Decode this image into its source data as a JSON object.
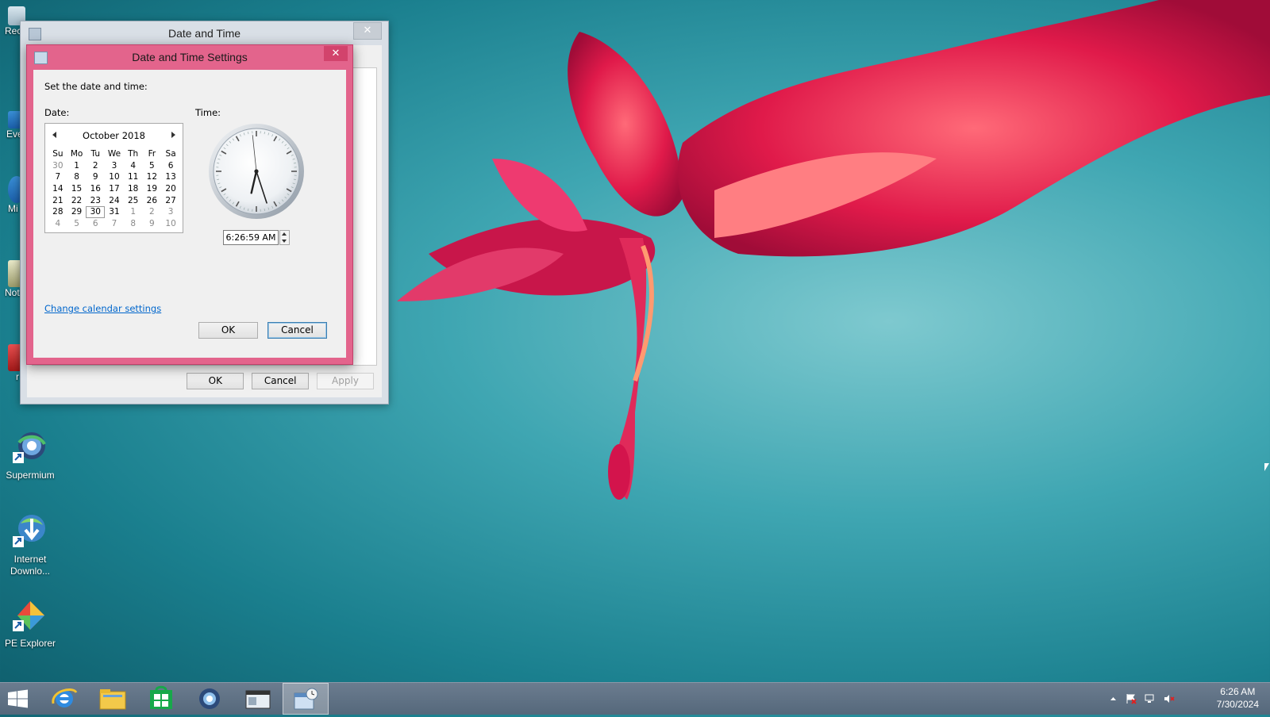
{
  "desktop": {
    "icons": [
      {
        "label": "Supermium"
      },
      {
        "label": "Internet Downlo..."
      },
      {
        "label": "PE Explorer"
      }
    ],
    "partial_labels": [
      "Rec",
      "Eve",
      "Mi",
      "Not",
      "r"
    ]
  },
  "outer_window": {
    "title": "Date and Time",
    "buttons": {
      "ok": "OK",
      "cancel": "Cancel",
      "apply": "Apply"
    }
  },
  "dialog": {
    "title": "Date and Time Settings",
    "instruction": "Set the date and time:",
    "date_label": "Date:",
    "time_label": "Time:",
    "calendar": {
      "month": "October 2018",
      "weekdays": [
        "Su",
        "Mo",
        "Tu",
        "We",
        "Th",
        "Fr",
        "Sa"
      ],
      "weeks": [
        [
          "30",
          "1",
          "2",
          "3",
          "4",
          "5",
          "6"
        ],
        [
          "7",
          "8",
          "9",
          "10",
          "11",
          "12",
          "13"
        ],
        [
          "14",
          "15",
          "16",
          "17",
          "18",
          "19",
          "20"
        ],
        [
          "21",
          "22",
          "23",
          "24",
          "25",
          "26",
          "27"
        ],
        [
          "28",
          "29",
          "30",
          "31",
          "1",
          "2",
          "3"
        ],
        [
          "4",
          "5",
          "6",
          "7",
          "8",
          "9",
          "10"
        ]
      ],
      "selected_day": "30"
    },
    "time_value": "6:26:59 AM",
    "clock": {
      "hour": 6,
      "minute": 26,
      "second": 59
    },
    "link": "Change calendar settings",
    "ok": "OK",
    "cancel": "Cancel"
  },
  "taskbar": {
    "apps": [
      "start-button",
      "internet-explorer",
      "file-explorer",
      "store",
      "supermium",
      "remote-app",
      "date-time"
    ],
    "active": "date-time",
    "clock_time": "6:26 AM",
    "clock_date": "7/30/2024"
  },
  "colors": {
    "dialog_accent": "#e3648c",
    "link": "#0066cc"
  }
}
